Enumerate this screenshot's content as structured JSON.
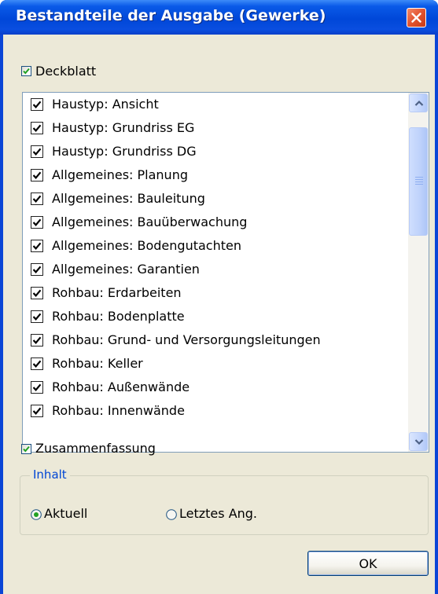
{
  "window": {
    "title": "Bestandteile der Ausgabe (Gewerke)"
  },
  "deckblatt": {
    "label": "Deckblatt",
    "checked": true
  },
  "items": [
    {
      "label": "Haustyp: Ansicht",
      "checked": true
    },
    {
      "label": "Haustyp: Grundriss EG",
      "checked": true
    },
    {
      "label": "Haustyp: Grundriss DG",
      "checked": true
    },
    {
      "label": "Allgemeines: Planung",
      "checked": true
    },
    {
      "label": "Allgemeines: Bauleitung",
      "checked": true
    },
    {
      "label": "Allgemeines: Bauüberwachung",
      "checked": true
    },
    {
      "label": "Allgemeines: Bodengutachten",
      "checked": true
    },
    {
      "label": "Allgemeines: Garantien",
      "checked": true
    },
    {
      "label": "Rohbau: Erdarbeiten",
      "checked": true
    },
    {
      "label": "Rohbau: Bodenplatte",
      "checked": true
    },
    {
      "label": "Rohbau: Grund- und Versorgungsleitungen",
      "checked": true
    },
    {
      "label": "Rohbau: Keller",
      "checked": true
    },
    {
      "label": "Rohbau: Außenwände",
      "checked": true
    },
    {
      "label": "Rohbau: Innenwände",
      "checked": true
    }
  ],
  "zusammenfassung": {
    "label": "Zusammenfassung",
    "checked": true
  },
  "inhalt": {
    "title": "Inhalt",
    "options": [
      {
        "label": "Aktuell",
        "selected": true
      },
      {
        "label": "Letztes Ang.",
        "selected": false
      }
    ]
  },
  "buttons": {
    "ok": "OK"
  },
  "icons": {
    "close": "close-icon",
    "check": "check-icon",
    "scroll_up": "chevron-up-icon",
    "scroll_down": "chevron-down-icon"
  },
  "colors": {
    "titlebar": "#0a45d6",
    "checkmark_green": "#21a121",
    "group_title": "#0046d5",
    "dialog_bg": "#ece9d8"
  }
}
